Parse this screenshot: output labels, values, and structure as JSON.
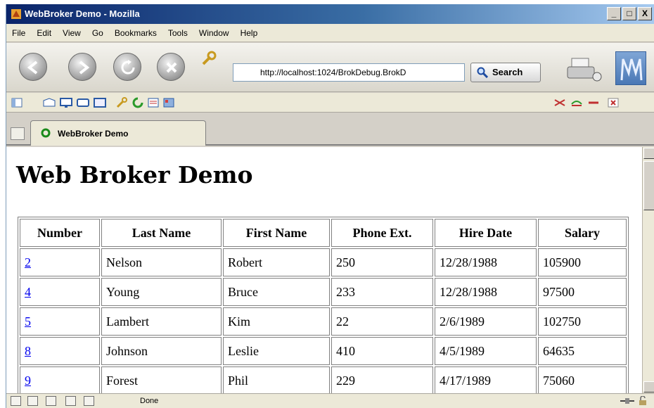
{
  "window": {
    "title": "WebBroker Demo - Mozilla",
    "buttons": {
      "minimize": "_",
      "maximize": "□",
      "close": "X"
    }
  },
  "menu": [
    "File",
    "Edit",
    "View",
    "Go",
    "Bookmarks",
    "Tools",
    "Window",
    "Help"
  ],
  "navigation": {
    "url": "http://localhost:1024/BrokDebug.BrokD",
    "search_label": "Search"
  },
  "tab": {
    "label": "WebBroker Demo"
  },
  "page": {
    "heading": "Web Broker Demo",
    "table": {
      "headers": [
        "Number",
        "Last Name",
        "First Name",
        "Phone Ext.",
        "Hire Date",
        "Salary"
      ],
      "rows": [
        [
          "2",
          "Nelson",
          "Robert",
          "250",
          "12/28/1988",
          "105900"
        ],
        [
          "4",
          "Young",
          "Bruce",
          "233",
          "12/28/1988",
          "97500"
        ],
        [
          "5",
          "Lambert",
          "Kim",
          "22",
          "2/6/1989",
          "102750"
        ],
        [
          "8",
          "Johnson",
          "Leslie",
          "410",
          "4/5/1989",
          "64635"
        ],
        [
          "9",
          "Forest",
          "Phil",
          "229",
          "4/17/1989",
          "75060"
        ]
      ]
    }
  },
  "status": {
    "text": "Done"
  },
  "colors": {
    "link": "#0000ee",
    "title_bar": "#0a246a"
  }
}
